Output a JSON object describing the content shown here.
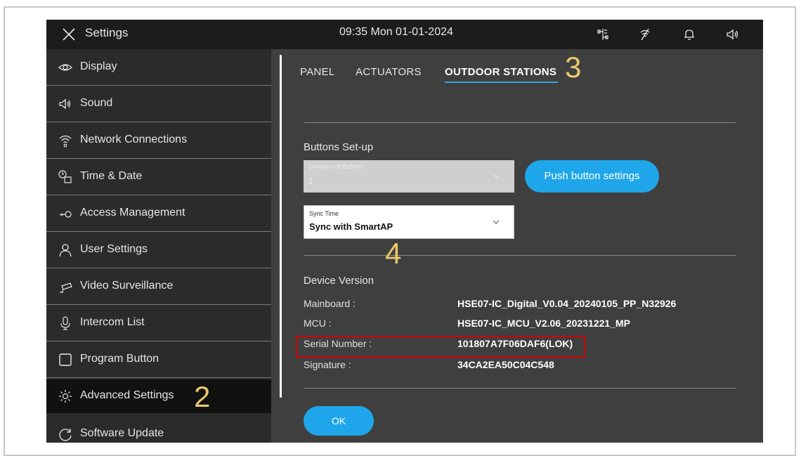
{
  "topbar": {
    "title": "Settings",
    "clock": "09:35  Mon 01-01-2024",
    "icons": [
      "close-icon",
      "network-topology-icon",
      "no-signal-icon",
      "bell-icon",
      "speaker-icon"
    ]
  },
  "sidebar": {
    "items": [
      {
        "label": "Display",
        "icon": "eye-icon"
      },
      {
        "label": "Sound",
        "icon": "speaker-icon"
      },
      {
        "label": "Network Connections",
        "icon": "wifi-icon"
      },
      {
        "label": "Time & Date",
        "icon": "clock-calendar-icon"
      },
      {
        "label": "Access Management",
        "icon": "key-icon"
      },
      {
        "label": "User Settings",
        "icon": "user-icon"
      },
      {
        "label": "Video Surveillance",
        "icon": "camera-icon"
      },
      {
        "label": "Intercom List",
        "icon": "microphone-icon"
      },
      {
        "label": "Program Button",
        "icon": "square-icon"
      },
      {
        "label": "Advanced Settings",
        "icon": "gear-icon"
      },
      {
        "label": "Software Update",
        "icon": "refresh-icon"
      }
    ],
    "active_index": 9
  },
  "tabs": {
    "panel": "PANEL",
    "actuators": "ACTUATORS",
    "outdoor_stations": "OUTDOOR STATIONS",
    "active": "OUTDOOR STATIONS"
  },
  "buttons_setup": {
    "title": "Buttons Set-up",
    "columns": {
      "label": "Columns of Buttons",
      "value": "1",
      "disabled": true
    },
    "push_button_label": "Push button settings",
    "sync_time": {
      "label": "Sync Time",
      "value": "Sync with SmartAP"
    }
  },
  "device_version": {
    "title": "Device Version",
    "rows": [
      {
        "label": "Mainboard :",
        "value": "HSE07-IC_Digital_V0.04_20240105_PP_N32926"
      },
      {
        "label": "MCU :",
        "value": "HSE07-IC_MCU_V2.06_20231221_MP"
      },
      {
        "label": "Serial Number :",
        "value": "101807A7F06DAF6(LOK)"
      },
      {
        "label": "Signature :",
        "value": "34CA2EA50C04C548"
      }
    ]
  },
  "ok_label": "OK",
  "annotations": {
    "step2": "2",
    "step3": "3",
    "step4": "4"
  },
  "colors": {
    "accent": "#1fa6ea",
    "highlight_box": "#d40000",
    "annotation": "#e8c86a"
  }
}
